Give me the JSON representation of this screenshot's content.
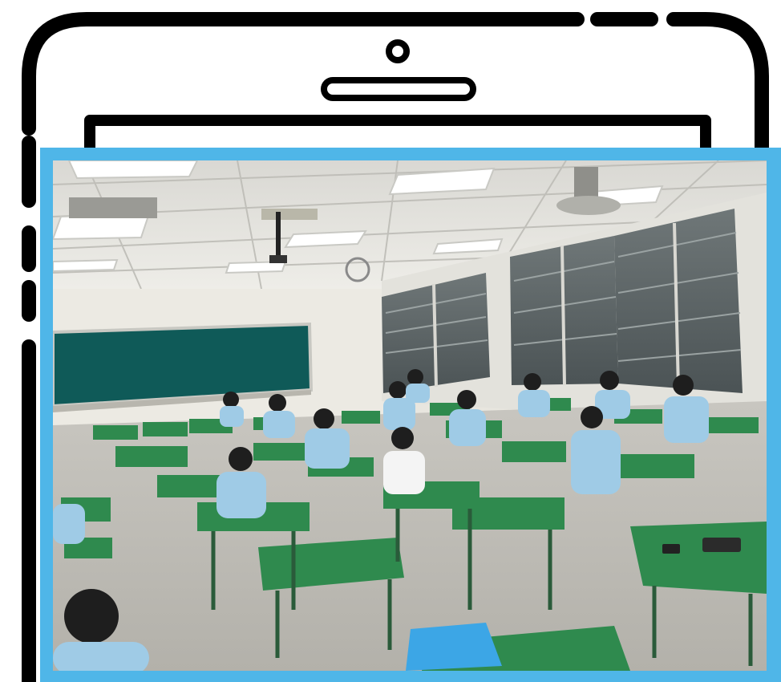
{
  "image": {
    "subject": "classroom-photo",
    "panel_border_color": "#4fb6e8",
    "frame_color": "#000000",
    "chalkboard_color": "#0f5a58",
    "desk_color": "#2f8a4e",
    "uniform_color": "#9fcbe6"
  },
  "frame": {
    "camera_icon": "camera-icon",
    "speaker_icon": "speaker-slot-icon"
  }
}
